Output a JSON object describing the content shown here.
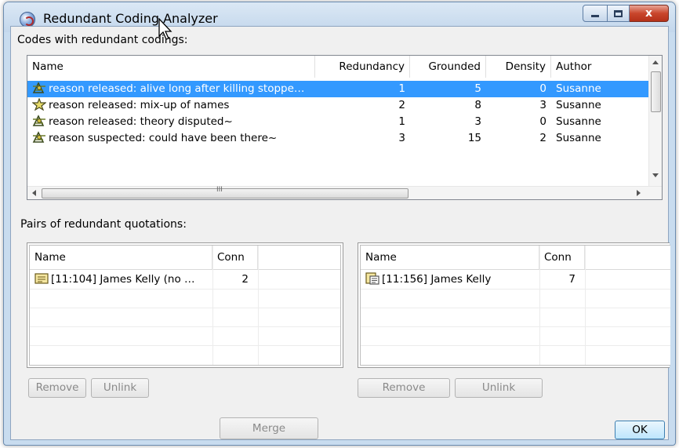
{
  "window": {
    "title": "Redundant Coding Analyzer",
    "close_glyph": "x"
  },
  "codes_section": {
    "label": "Codes with redundant codings:",
    "columns": [
      "Name",
      "Redundancy",
      "Grounded",
      "Density",
      "Author"
    ],
    "rows": [
      {
        "name": "reason released: alive long after killing stoppe…",
        "redundancy": "1",
        "grounded": "5",
        "density": "0",
        "author": "Susanne",
        "selected": true
      },
      {
        "name": "reason released: mix-up of names",
        "redundancy": "2",
        "grounded": "8",
        "density": "3",
        "author": "Susanne",
        "selected": false
      },
      {
        "name": "reason released: theory disputed~",
        "redundancy": "1",
        "grounded": "3",
        "density": "0",
        "author": "Susanne",
        "selected": false
      },
      {
        "name": "reason suspected: could have been there~",
        "redundancy": "3",
        "grounded": "15",
        "density": "2",
        "author": "Susanne",
        "selected": false
      }
    ],
    "hscroll_grip": "III"
  },
  "pairs_section": {
    "label": "Pairs of redundant quotations:",
    "left": {
      "columns": [
        "Name",
        "Conn"
      ],
      "rows": [
        {
          "name": "[11:104] James Kelly (no …",
          "conn": "2"
        }
      ],
      "remove_label": "Remove",
      "unlink_label": "Unlink"
    },
    "right": {
      "columns": [
        "Name",
        "Conn"
      ],
      "rows": [
        {
          "name": "[11:156] James Kelly",
          "conn": "7"
        }
      ],
      "remove_label": "Remove",
      "unlink_label": "Unlink"
    }
  },
  "footer": {
    "merge_label": "Merge",
    "ok_label": "OK"
  },
  "colors": {
    "selection": "#3399ff",
    "window_frame": "#c8dcef",
    "close_button": "#c9462c"
  },
  "icons": [
    "app-logo-icon",
    "code-redundant-icon",
    "text-quotation-icon",
    "document-quotation-icon",
    "mouse-cursor-icon"
  ]
}
